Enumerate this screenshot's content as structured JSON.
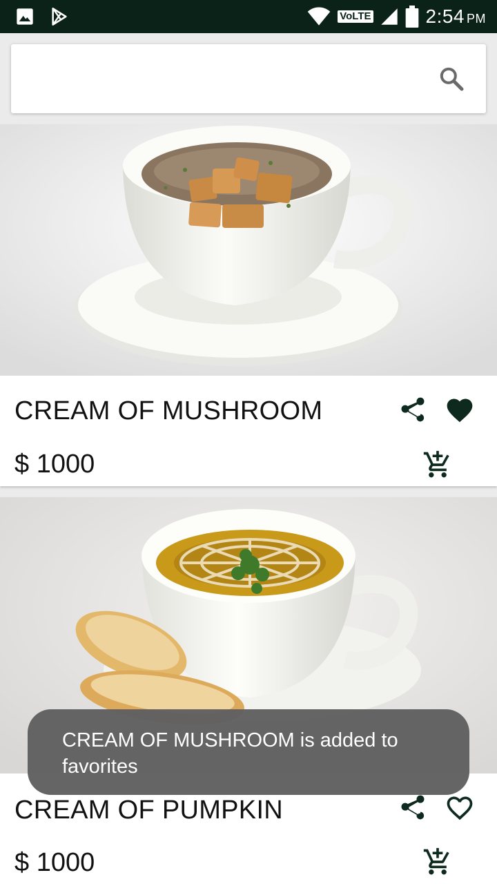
{
  "status_bar": {
    "time": "2:54",
    "ampm": "PM",
    "network_label": "VoLTE",
    "left_icons": [
      "gallery-icon",
      "play-store-icon"
    ],
    "right_icons": [
      "wifi-icon",
      "signal-icon",
      "battery-icon"
    ]
  },
  "search": {
    "value": "",
    "placeholder": "",
    "icon": "search-icon"
  },
  "products": [
    {
      "name": "CREAM OF MUSHROOM",
      "price": "$ 1000",
      "favorited": true,
      "image": "mushroom-soup-cup"
    },
    {
      "name": "CREAM OF PUMPKIN",
      "price": "$ 1000",
      "favorited": false,
      "image": "pumpkin-soup-cup"
    }
  ],
  "toast": {
    "message": "CREAM OF MUSHROOM is added to favorites"
  },
  "colors": {
    "status_bar": "#0a2218",
    "icon": "#0e2a1e",
    "toast_bg": "#606060"
  }
}
